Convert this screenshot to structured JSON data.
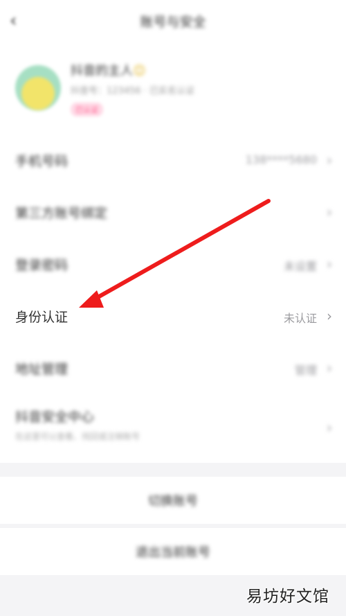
{
  "header": {
    "back_icon": "‹",
    "title": "账号与安全"
  },
  "profile": {
    "nickname": "抖音的主人",
    "emoji": "😊",
    "meta": "抖音号：123456 · 已实名认证",
    "badge": "已认证"
  },
  "settings": {
    "items": [
      {
        "label": "手机号码",
        "value": "138****5680",
        "blurred": true
      },
      {
        "label": "第三方账号绑定",
        "value": "",
        "blurred": true
      },
      {
        "label": "登录密码",
        "value": "未设置",
        "blurred": true
      },
      {
        "label": "身份认证",
        "value": "未认证",
        "blurred": false
      },
      {
        "label": "地址管理",
        "value": "管理",
        "blurred": true
      },
      {
        "label": "抖音安全中心",
        "sub": "在这里可以查看、找回或注销账号",
        "value": "",
        "blurred": true
      }
    ],
    "chevron_icon": "›"
  },
  "actions": {
    "switch_account": "切换账号",
    "logout": "退出当前账号"
  },
  "watermark": "易坊好文馆",
  "annotation": {
    "arrow_color": "#ee1c1c"
  }
}
